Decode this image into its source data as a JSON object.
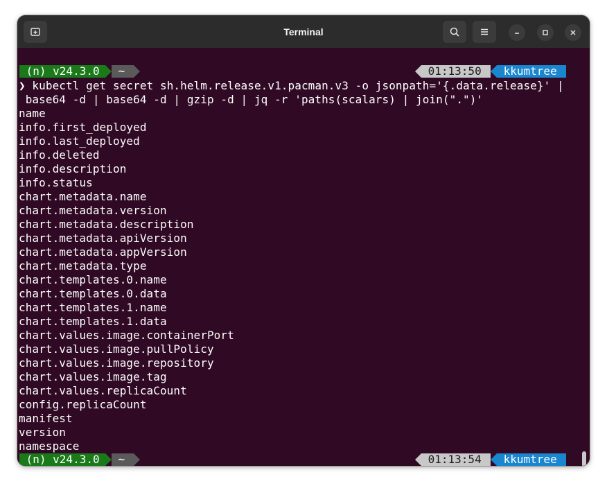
{
  "window": {
    "title": "Terminal"
  },
  "icons": {
    "new_tab": "new-tab-icon",
    "search": "search-icon",
    "menu": "hamburger-menu-icon",
    "minimize": "minimize-icon",
    "maximize": "maximize-icon",
    "close": "close-icon"
  },
  "prompt1": {
    "node": " (n) v24.3.0 ",
    "dir": " ~ ",
    "time": " 01:13:50 ",
    "context": " kkumtree "
  },
  "command": {
    "chevron": "❯",
    "line1": " kubectl get secret sh.helm.release.v1.pacman.v3 -o jsonpath='{.data.release}' |",
    "line2": " base64 -d | base64 -d | gzip -d | jq -r 'paths(scalars) | join(\".\")'"
  },
  "output": [
    "name",
    "info.first_deployed",
    "info.last_deployed",
    "info.deleted",
    "info.description",
    "info.status",
    "chart.metadata.name",
    "chart.metadata.version",
    "chart.metadata.description",
    "chart.metadata.apiVersion",
    "chart.metadata.appVersion",
    "chart.metadata.type",
    "chart.templates.0.name",
    "chart.templates.0.data",
    "chart.templates.1.name",
    "chart.templates.1.data",
    "chart.values.image.containerPort",
    "chart.values.image.pullPolicy",
    "chart.values.image.repository",
    "chart.values.image.tag",
    "chart.values.replicaCount",
    "config.replicaCount",
    "manifest",
    "version",
    "namespace"
  ],
  "prompt2": {
    "node": " (n) v24.3.0 ",
    "dir": " ~ ",
    "time": " 01:13:54 ",
    "context": " kkumtree "
  },
  "cursor_prompt": "❯",
  "colors": {
    "background": "#300a24",
    "node_segment": "#1a7a1a",
    "dir_segment": "#5a5a5a",
    "time_segment": "#c8c8c8",
    "context_segment": "#1a86d0"
  }
}
